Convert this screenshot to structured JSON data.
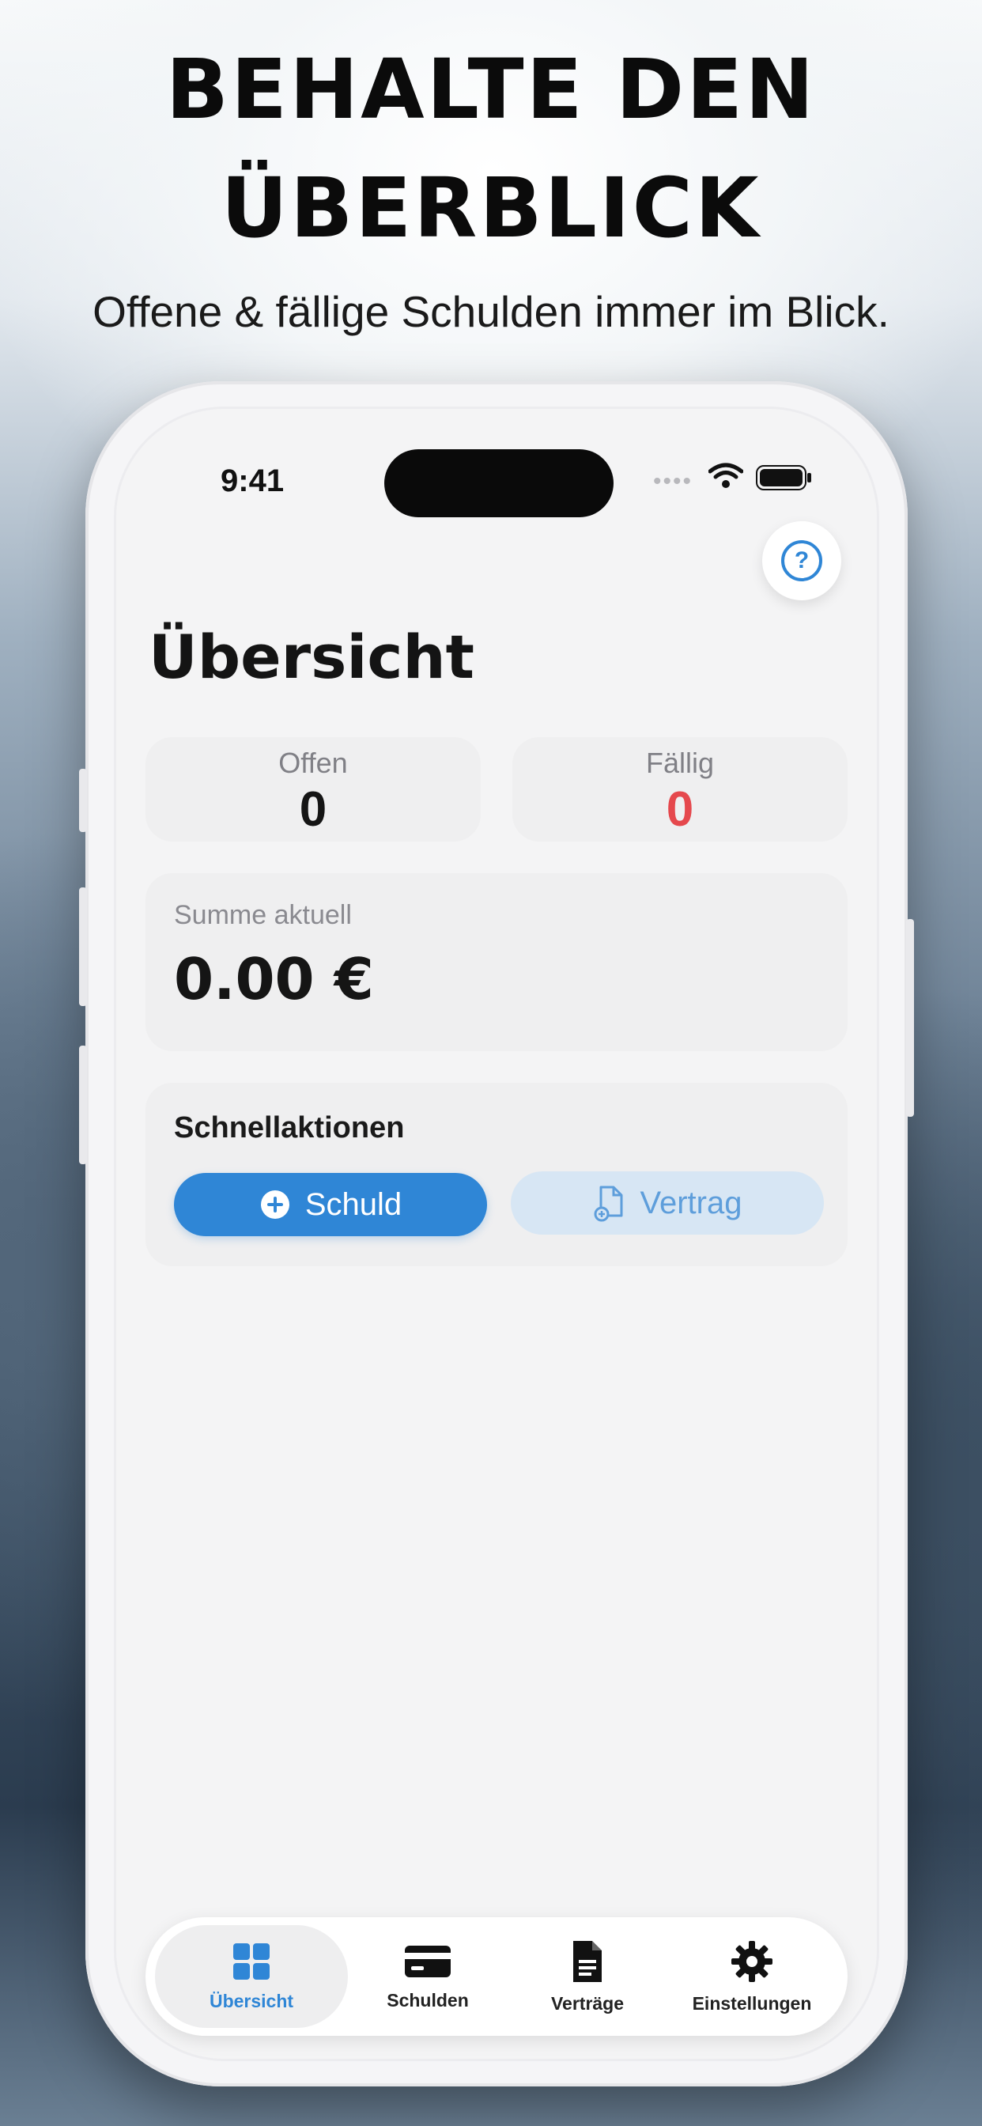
{
  "promo": {
    "headline_line1": "BEHALTE DEN",
    "headline_line2": "ÜBERBLICK",
    "subheadline": "Offene & fällige Schulden immer im Blick."
  },
  "status_bar": {
    "time": "9:41"
  },
  "header": {
    "title": "Übersicht",
    "help_icon": "question-circle-icon"
  },
  "stats": {
    "open_label": "Offen",
    "open_value": "0",
    "due_label": "Fällig",
    "due_value": "0"
  },
  "sum": {
    "label": "Summe aktuell",
    "value": "0.00 €"
  },
  "quick_actions": {
    "title": "Schnellaktionen",
    "debt_button": "Schuld",
    "contract_button": "Vertrag"
  },
  "tabs": [
    {
      "label": "Übersicht",
      "icon": "grid-icon",
      "active": true
    },
    {
      "label": "Schulden",
      "icon": "card-icon",
      "active": false
    },
    {
      "label": "Verträge",
      "icon": "document-icon",
      "active": false
    },
    {
      "label": "Einstellungen",
      "icon": "gear-icon",
      "active": false
    }
  ],
  "colors": {
    "accent": "#2f86d6",
    "due": "#e5484d",
    "accent_light": "#d7e6f4"
  }
}
